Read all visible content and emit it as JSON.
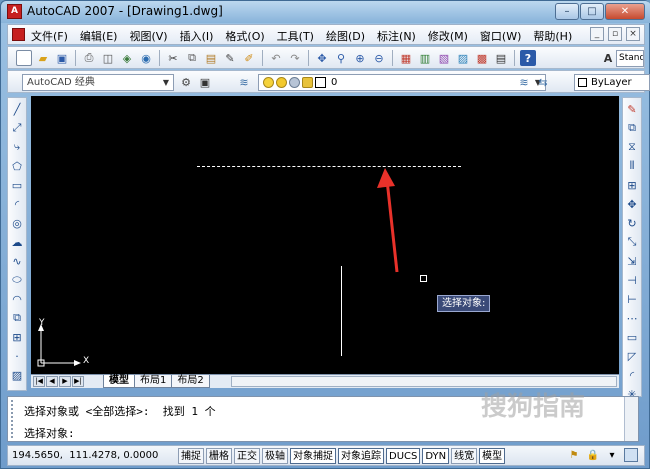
{
  "window": {
    "title": "AutoCAD 2007 - [Drawing1.dwg]",
    "app_icon_letter": "A"
  },
  "window_buttons": {
    "minimize": "–",
    "maximize": "□",
    "close": "✕"
  },
  "menu": {
    "items": [
      "文件(F)",
      "编辑(E)",
      "视图(V)",
      "插入(I)",
      "格式(O)",
      "工具(T)",
      "绘图(D)",
      "标注(N)",
      "修改(M)",
      "窗口(W)",
      "帮助(H)"
    ],
    "mdi_minimize": "_",
    "mdi_restore": "▫",
    "mdi_close": "×"
  },
  "toolbar1": {
    "icons": [
      "new-icon",
      "open-icon",
      "save-icon",
      "plot-icon",
      "plot-preview-icon",
      "publish-icon",
      "3d-dwf-icon",
      "cut-icon",
      "copy-icon",
      "paste-icon",
      "match-properties-icon",
      "block-editor-icon",
      "undo-icon",
      "redo-icon",
      "pan-icon",
      "zoom-realtime-icon",
      "zoom-window-icon",
      "zoom-previous-icon",
      "properties-icon",
      "design-center-icon",
      "tool-palettes-icon",
      "sheet-set-icon",
      "markup-icon",
      "quickcalc-icon",
      "help-icon"
    ],
    "text_style": "Stand"
  },
  "toolbar2": {
    "workspace": "AutoCAD 经典",
    "layer_value": "0",
    "linetype": "ByLayer"
  },
  "canvas": {
    "tooltip": "选择对象:",
    "ucs_x": "X",
    "ucs_y": "Y"
  },
  "tabs": {
    "nav": [
      "|◀",
      "◀",
      "▶",
      "▶|"
    ],
    "items": [
      "模型",
      "布局1",
      "布局2"
    ],
    "active_index": 0
  },
  "command": {
    "line1": "选择对象或 <全部选择>:  找到 1 个",
    "line2": "选择对象:"
  },
  "status": {
    "coords": "194.5650,  111.4278, 0.0000",
    "buttons": [
      "捕捉",
      "栅格",
      "正交",
      "极轴",
      "对象捕捉",
      "对象追踪",
      "DUCS",
      "DYN",
      "线宽",
      "模型"
    ],
    "on_buttons": [
      "对象捕捉",
      "对象追踪",
      "DUCS",
      "DYN",
      "模型"
    ]
  },
  "watermark": "搜狗指南",
  "colors": {
    "canvas": "#000000",
    "arrow": "#e8312a",
    "title_gradient_top": "#bcd8ef"
  }
}
